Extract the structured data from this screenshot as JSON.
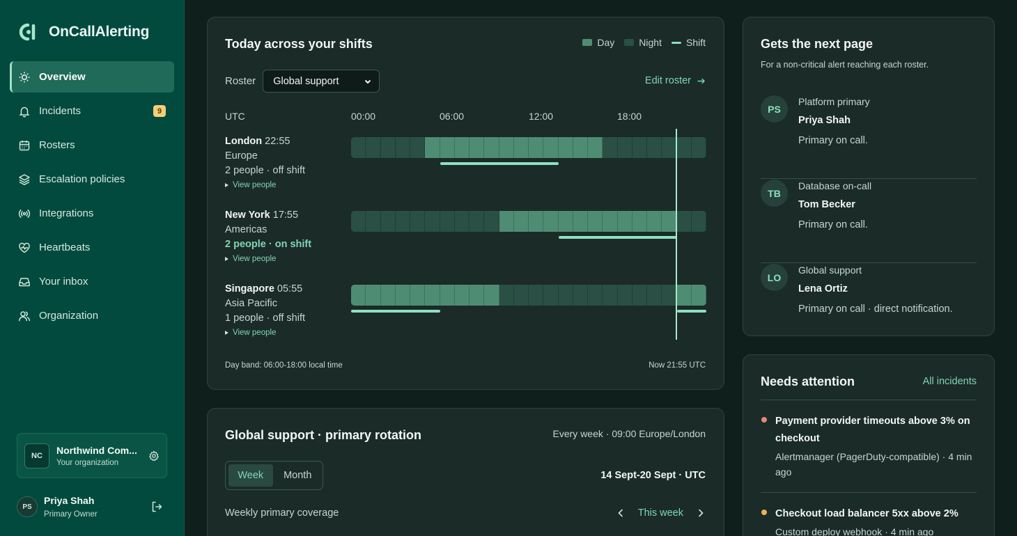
{
  "app": {
    "name": "OnCallAlerting"
  },
  "sidebar": {
    "items": [
      {
        "label": "Overview",
        "icon": "sun-icon"
      },
      {
        "label": "Incidents",
        "icon": "bell-icon",
        "badge": "9"
      },
      {
        "label": "Rosters",
        "icon": "calendar-icon"
      },
      {
        "label": "Escalation policies",
        "icon": "layers-icon"
      },
      {
        "label": "Integrations",
        "icon": "broadcast-icon"
      },
      {
        "label": "Heartbeats",
        "icon": "heart-pulse-icon"
      },
      {
        "label": "Your inbox",
        "icon": "inbox-icon"
      },
      {
        "label": "Organization",
        "icon": "users-icon"
      }
    ],
    "org": {
      "initials": "NC",
      "name": "Northwind Com...",
      "sub": "Your organization"
    },
    "user": {
      "initials": "PS",
      "name": "Priya Shah",
      "role": "Primary Owner"
    }
  },
  "shifts": {
    "title": "Today across your shifts",
    "legend": {
      "day": "Day",
      "night": "Night",
      "shift": "Shift"
    },
    "roster_label": "Roster",
    "roster_value": "Global support",
    "edit_roster": "Edit roster",
    "timezone": "UTC",
    "hours": [
      "00:00",
      "06:00",
      "12:00",
      "18:00"
    ],
    "regions": [
      {
        "city": "London",
        "time": "22:55",
        "area": "Europe",
        "people": "2 people · off shift",
        "on_shift": false,
        "view": "View people",
        "day_start": 5,
        "day_end": 17,
        "shifts": [
          [
            6,
            14
          ]
        ]
      },
      {
        "city": "New York",
        "time": "17:55",
        "area": "Americas",
        "people": "2 people · on shift",
        "on_shift": true,
        "view": "View people",
        "day_start": 10,
        "day_end": 22,
        "shifts": [
          [
            14,
            22
          ]
        ]
      },
      {
        "city": "Singapore",
        "time": "05:55",
        "area": "Asia Pacific",
        "people": "1 people · off shift",
        "on_shift": false,
        "view": "View people",
        "day_start": 22,
        "day_end": 34,
        "shifts": [
          [
            0,
            6
          ],
          [
            22,
            24
          ]
        ]
      }
    ],
    "now_hour": 21.92,
    "footer_left": "Day band: 06:00-18:00 local time",
    "footer_right": "Now 21:55 UTC"
  },
  "rotation": {
    "title": "Global support · primary rotation",
    "schedule": "Every week · 09:00 Europe/London",
    "tabs": [
      "Week",
      "Month"
    ],
    "active_tab": 0,
    "date_range": "14 Sept-20 Sept · UTC",
    "coverage_label": "Weekly primary coverage",
    "this_week": "This week"
  },
  "next_page": {
    "title": "Gets the next page",
    "subtitle": "For a non-critical alert reaching each roster.",
    "items": [
      {
        "initials": "PS",
        "roster": "Platform primary",
        "name": "Priya Shah",
        "desc": "Primary on call."
      },
      {
        "initials": "TB",
        "roster": "Database on-call",
        "name": "Tom Becker",
        "desc": "Primary on call."
      },
      {
        "initials": "LO",
        "roster": "Global support",
        "name": "Lena Ortiz",
        "desc": "Primary on call · direct notification."
      }
    ]
  },
  "attention": {
    "title": "Needs attention",
    "link": "All incidents",
    "items": [
      {
        "title": "Payment provider timeouts above 3% on checkout",
        "meta": "Alertmanager (PagerDuty-compatible) · 4 min ago",
        "color": "#e8867a"
      },
      {
        "title": "Checkout load balancer 5xx above 2%",
        "meta": "Custom deploy webhook · 4 min ago",
        "color": "#e9b25a"
      }
    ]
  },
  "colors": {
    "accent": "#7fd6b4",
    "sidebar": "#024a3d",
    "background": "#0f1f1b"
  }
}
